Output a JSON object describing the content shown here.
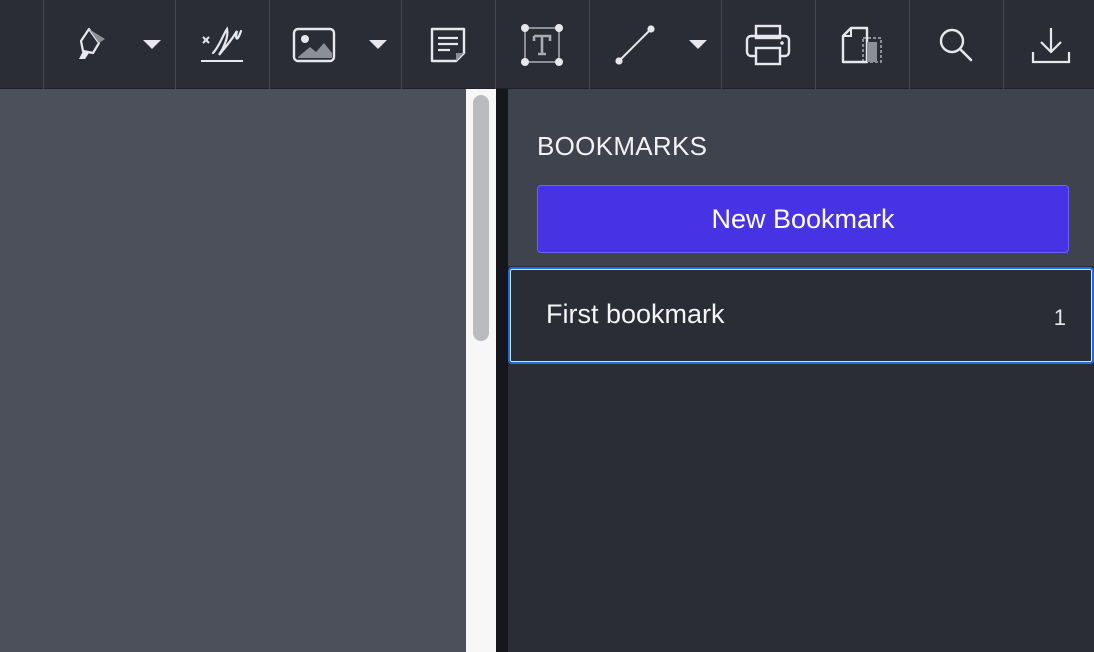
{
  "toolbar": {
    "icons": [
      "highlighter-icon",
      "signature-icon",
      "image-icon",
      "note-icon",
      "text-box-icon",
      "line-icon",
      "printer-icon",
      "copy-page-icon",
      "search-icon",
      "download-icon"
    ]
  },
  "bookmarks": {
    "title": "BOOKMARKS",
    "new_label": "New Bookmark",
    "items": [
      {
        "label": "First bookmark",
        "page": "1"
      }
    ]
  },
  "colors": {
    "accent": "#4733e4",
    "selection": "#1f6fe0",
    "toolbar": "#2b2d36"
  }
}
